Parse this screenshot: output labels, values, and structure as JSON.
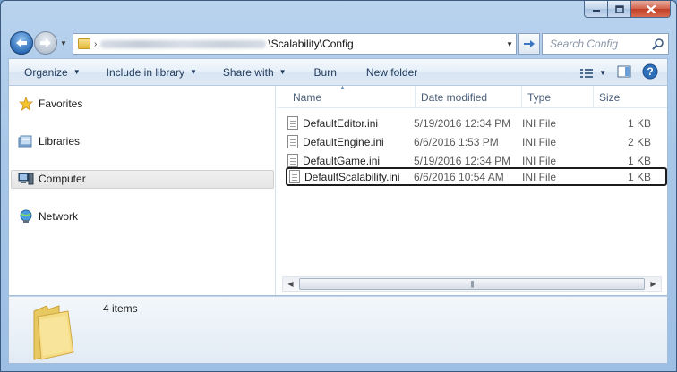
{
  "window": {
    "caption_buttons": [
      {
        "name": "minimize-button",
        "icon": "minimize-icon"
      },
      {
        "name": "maximize-button",
        "icon": "maximize-icon"
      },
      {
        "name": "close-button",
        "icon": "close-icon"
      }
    ]
  },
  "address": {
    "path_visible": "\\Scalability\\Config",
    "search_placeholder": "Search Config"
  },
  "toolbar": {
    "organize": "Organize",
    "include_in_library": "Include in library",
    "share_with": "Share with",
    "burn": "Burn",
    "new_folder": "New folder"
  },
  "nav": {
    "favorites": "Favorites",
    "libraries": "Libraries",
    "computer": "Computer",
    "network": "Network",
    "selected": "Computer"
  },
  "columns": {
    "name": "Name",
    "date_modified": "Date modified",
    "type": "Type",
    "size": "Size"
  },
  "files": [
    {
      "name": "DefaultEditor.ini",
      "date": "5/19/2016 12:34 PM",
      "type": "INI File",
      "size": "1 KB"
    },
    {
      "name": "DefaultEngine.ini",
      "date": "6/6/2016 1:53 PM",
      "type": "INI File",
      "size": "2 KB"
    },
    {
      "name": "DefaultGame.ini",
      "date": "5/19/2016 12:34 PM",
      "type": "INI File",
      "size": "1 KB"
    },
    {
      "name": "DefaultScalability.ini",
      "date": "6/6/2016 10:54 AM",
      "type": "INI File",
      "size": "1 KB",
      "selected": true
    }
  ],
  "details": {
    "items_count": "4 items"
  },
  "colors": {
    "accent": "#1c1c1c",
    "link": "#1e395b",
    "frame": "#a8c7e8"
  }
}
